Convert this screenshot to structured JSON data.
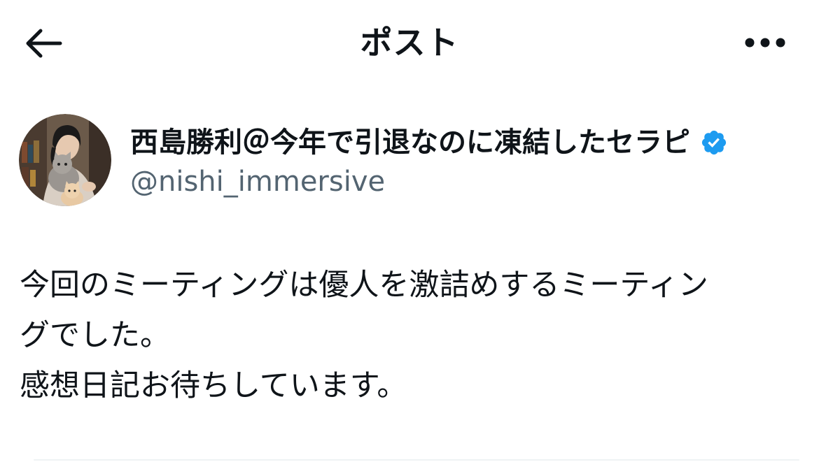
{
  "header": {
    "title": "ポスト",
    "back_icon": "arrow-left-icon",
    "more_icon": "more-horizontal-icon"
  },
  "author": {
    "display_name": "西島勝利＠今年で引退なのに凍結したセラピ",
    "handle": "@nishi_immersive",
    "verified": true,
    "verified_color": "#1d9bf0"
  },
  "post": {
    "lines": [
      "今回のミーティングは優人を激詰めするミーティン",
      "グでした。",
      "感想日記お待ちしています。"
    ]
  },
  "colors": {
    "text": "#0f1419",
    "secondary": "#536471",
    "accent": "#1d9bf0"
  }
}
